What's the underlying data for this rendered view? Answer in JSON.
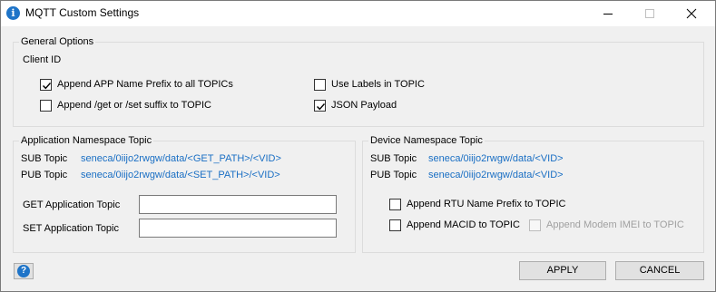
{
  "window": {
    "title": "MQTT Custom Settings",
    "icon": "info-icon",
    "controls": {
      "minimize": "minimize-icon",
      "maximize": "maximize-icon",
      "close": "close-icon"
    }
  },
  "general": {
    "group_label": "General Options",
    "client_id_label": "Client ID",
    "append_app_prefix": {
      "label": "Append APP Name Prefix to all TOPICs",
      "checked": true
    },
    "append_get_set_suffix": {
      "label": "Append /get or /set suffix to TOPIC",
      "checked": false
    },
    "use_labels": {
      "label": "Use Labels in TOPIC",
      "checked": false
    },
    "json_payload": {
      "label": "JSON Payload",
      "checked": true
    }
  },
  "app_ns": {
    "group_label": "Application Namespace Topic",
    "sub_label": "SUB Topic",
    "sub_value": "seneca/0iijo2rwgw/data/<GET_PATH>/<VID>",
    "pub_label": "PUB Topic",
    "pub_value": "seneca/0iijo2rwgw/data/<SET_PATH>/<VID>",
    "get_label": "GET Application Topic",
    "get_value": "",
    "set_label": "SET Application Topic",
    "set_value": ""
  },
  "dev_ns": {
    "group_label": "Device Namespace Topic",
    "sub_label": "SUB Topic",
    "sub_value": "seneca/0iijo2rwgw/data/<VID>",
    "pub_label": "PUB Topic",
    "pub_value": "seneca/0iijo2rwgw/data/<VID>",
    "append_rtu_prefix": {
      "label": "Append RTU Name Prefix to TOPIC",
      "checked": false
    },
    "append_macid": {
      "label": "Append MACID to TOPIC",
      "checked": false
    },
    "append_imei": {
      "label": "Append Modem IMEI to TOPIC",
      "checked": false,
      "enabled": false
    }
  },
  "footer": {
    "help_icon": "help-icon",
    "apply_label": "APPLY",
    "cancel_label": "CANCEL"
  },
  "colors": {
    "link": "#1a6fc4",
    "accent": "#1e74c8"
  }
}
